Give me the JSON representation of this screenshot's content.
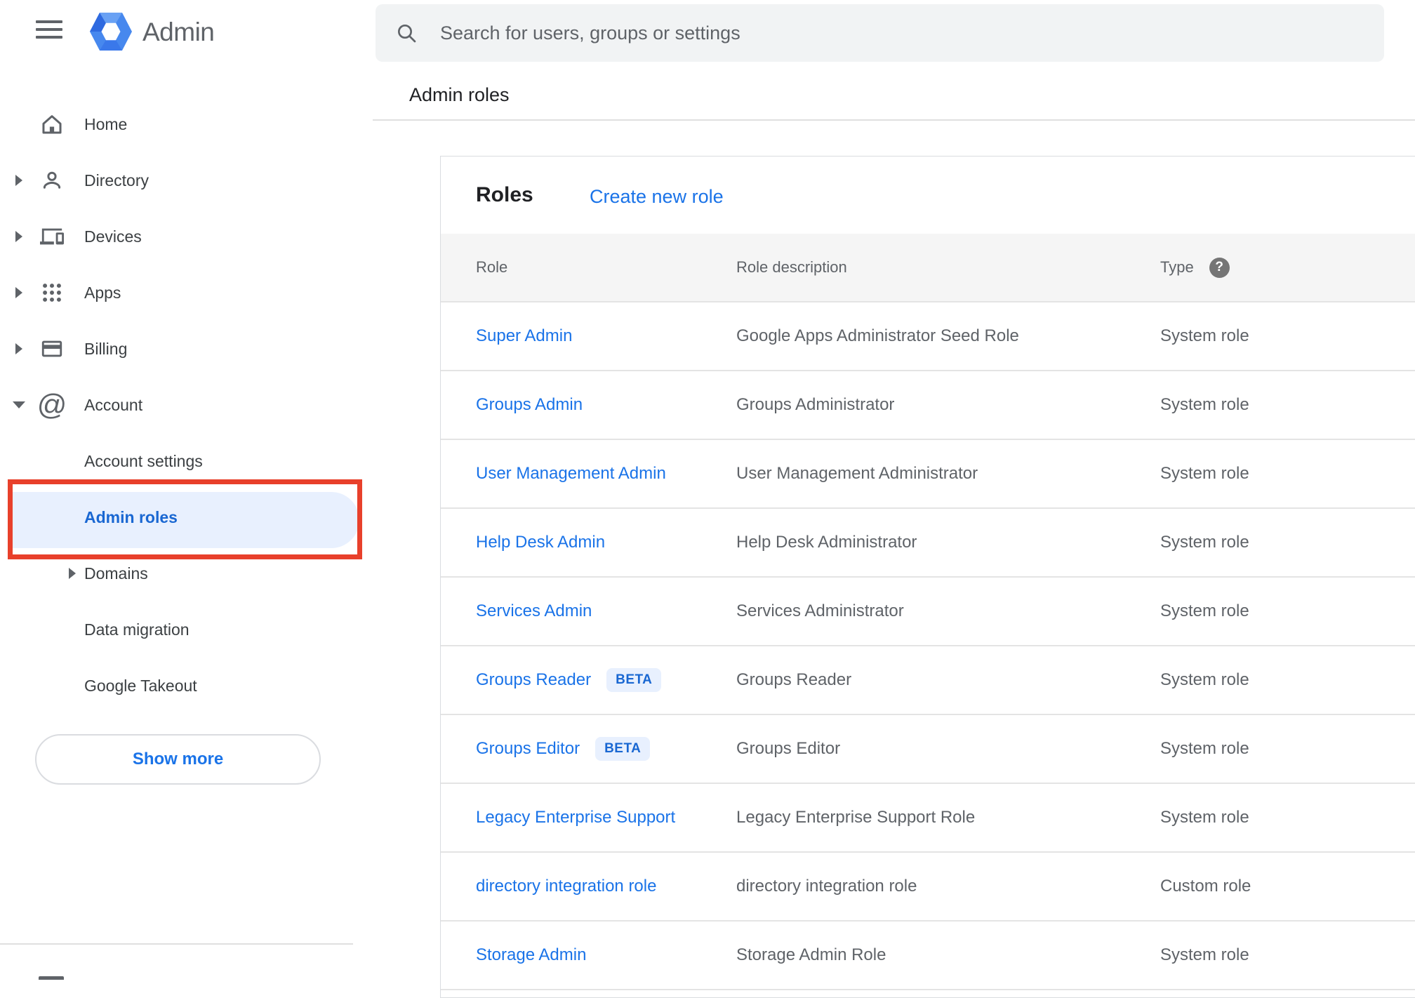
{
  "topbar": {
    "app_title": "Admin",
    "search_placeholder": "Search for users, groups or settings"
  },
  "page": {
    "breadcrumb": "Admin roles"
  },
  "sidebar": {
    "items": [
      {
        "label": "Home",
        "icon": "home-icon",
        "expandable": false
      },
      {
        "label": "Directory",
        "icon": "person-icon",
        "expandable": true
      },
      {
        "label": "Devices",
        "icon": "devices-icon",
        "expandable": true
      },
      {
        "label": "Apps",
        "icon": "apps-grid-icon",
        "expandable": true
      },
      {
        "label": "Billing",
        "icon": "credit-card-icon",
        "expandable": true
      },
      {
        "label": "Account",
        "icon": "at-sign-icon",
        "expanded": true
      }
    ],
    "account_children": [
      {
        "label": "Account settings"
      },
      {
        "label": "Admin roles",
        "selected": true,
        "annotated": true
      },
      {
        "label": "Domains",
        "expandable": true
      },
      {
        "label": "Data migration"
      },
      {
        "label": "Google Takeout"
      }
    ],
    "show_more_label": "Show more"
  },
  "roles_card": {
    "title": "Roles",
    "create_link": "Create new role",
    "columns": [
      "Role",
      "Role description",
      "Type"
    ],
    "help_icon": "?",
    "rows": [
      {
        "role": "Super Admin",
        "description": "Google Apps Administrator Seed Role",
        "type": "System role"
      },
      {
        "role": "Groups Admin",
        "description": "Groups Administrator",
        "type": "System role"
      },
      {
        "role": "User Management Admin",
        "description": "User Management Administrator",
        "type": "System role"
      },
      {
        "role": "Help Desk Admin",
        "description": "Help Desk Administrator",
        "type": "System role"
      },
      {
        "role": "Services Admin",
        "description": "Services Administrator",
        "type": "System role"
      },
      {
        "role": "Groups Reader",
        "badge": "BETA",
        "description": "Groups Reader",
        "type": "System role"
      },
      {
        "role": "Groups Editor",
        "badge": "BETA",
        "description": "Groups Editor",
        "type": "System role"
      },
      {
        "role": "Legacy Enterprise Support",
        "description": "Legacy Enterprise Support Role",
        "type": "System role"
      },
      {
        "role": "directory integration role",
        "description": "directory integration role",
        "type": "Custom role"
      },
      {
        "role": "Storage Admin",
        "description": "Storage Admin Role",
        "type": "System role"
      }
    ]
  },
  "colors": {
    "link_blue": "#1a73e8",
    "selected_blue": "#1967d2",
    "selected_bg": "#e8f0fe",
    "beta_bg": "#e8f0fe",
    "beta_text": "#1967d2",
    "annotation_red": "#e8402b",
    "search_bg": "#f1f3f4",
    "table_header_bg": "#f5f5f5",
    "divider": "#e0e0e0",
    "text_primary": "#202124",
    "text_secondary": "#5f6368",
    "sidebar_text": "#3c4043"
  }
}
